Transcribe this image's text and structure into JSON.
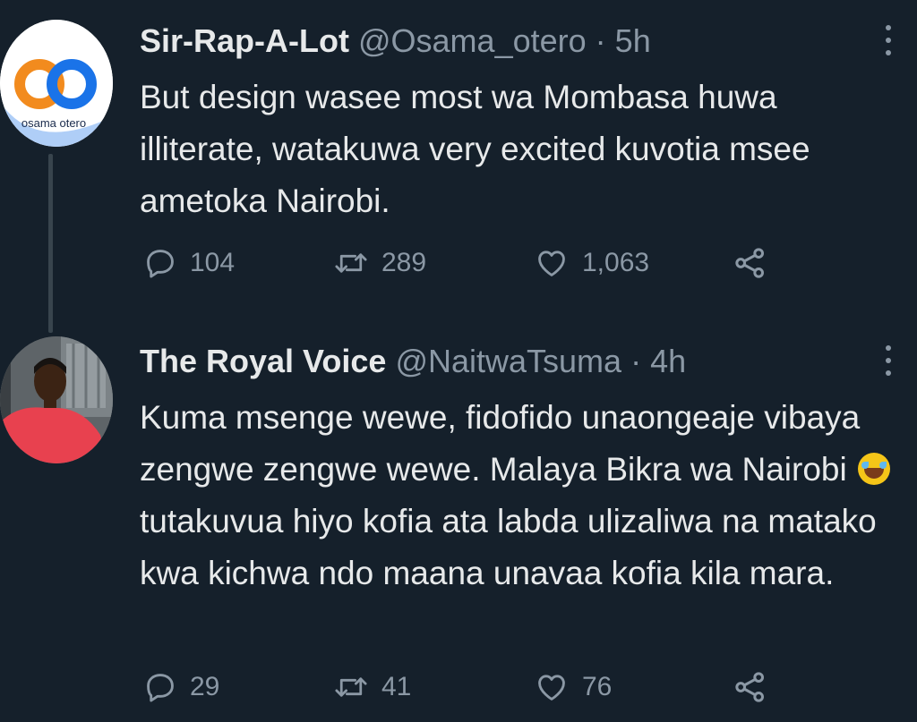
{
  "tweets": [
    {
      "display_name": "Sir-Rap-A-Lot",
      "handle": "@Osama_otero",
      "time": "5h",
      "avatar_logo_text": "osama otero",
      "text": "But design wasee most wa Mombasa huwa illiterate, watakuwa very excited kuvotia msee ametoka Nairobi.",
      "replies": "104",
      "retweets": "289",
      "likes": "1,063"
    },
    {
      "display_name": "The Royal Voice",
      "handle": "@NaitwaTsuma",
      "time": "4h",
      "text_part1": "Kuma msenge wewe, fidofido unaongeaje vibaya zengwe zengwe wewe. Malaya Bikra wa Nairobi",
      "text_emoji": "face-with-tears-of-joy-emoji",
      "text_part2": "tutakuvua hiyo kofia ata labda ulizaliwa na matako kwa kichwa ndo maana unavaa kofia kila mara.",
      "replies": "29",
      "retweets": "41",
      "likes": "76"
    }
  ],
  "separator": "·",
  "icons": {
    "reply": "reply-icon",
    "retweet": "retweet-icon",
    "like": "like-icon",
    "share": "share-icon",
    "more": "more-options-icon"
  },
  "colors": {
    "background": "#15202b",
    "text_primary": "#e7e9ea",
    "text_secondary": "#8b98a5",
    "thread_line": "#38444d"
  }
}
